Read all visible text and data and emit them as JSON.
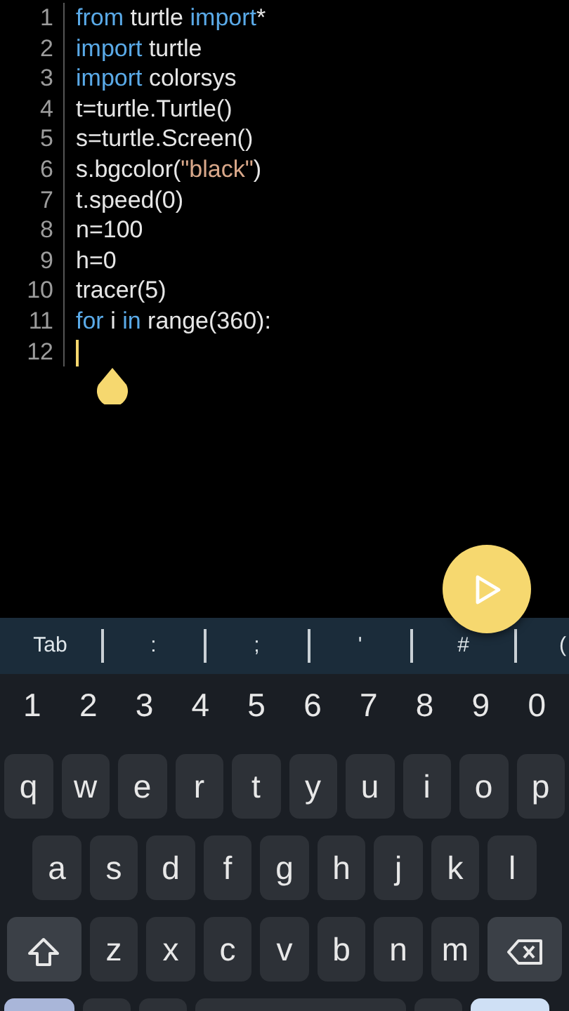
{
  "editor": {
    "lines": [
      {
        "number": "1",
        "cursor": false,
        "tokens": [
          {
            "text": "from",
            "kind": "keyword"
          },
          {
            "text": " turtle ",
            "kind": "plain"
          },
          {
            "text": "import",
            "kind": "keyword"
          },
          {
            "text": "*",
            "kind": "plain"
          }
        ]
      },
      {
        "number": "2",
        "cursor": false,
        "tokens": [
          {
            "text": "import",
            "kind": "keyword"
          },
          {
            "text": " turtle",
            "kind": "plain"
          }
        ]
      },
      {
        "number": "3",
        "cursor": false,
        "tokens": [
          {
            "text": "import",
            "kind": "keyword"
          },
          {
            "text": " colorsys",
            "kind": "plain"
          }
        ]
      },
      {
        "number": "4",
        "cursor": false,
        "tokens": [
          {
            "text": "t=turtle.Turtle()",
            "kind": "plain"
          }
        ]
      },
      {
        "number": "5",
        "cursor": false,
        "tokens": [
          {
            "text": "s=turtle.Screen()",
            "kind": "plain"
          }
        ]
      },
      {
        "number": "6",
        "cursor": false,
        "tokens": [
          {
            "text": "s.bgcolor(",
            "kind": "plain"
          },
          {
            "text": "\"black\"",
            "kind": "string"
          },
          {
            "text": ")",
            "kind": "plain"
          }
        ]
      },
      {
        "number": "7",
        "cursor": false,
        "tokens": [
          {
            "text": "t.speed(0)",
            "kind": "plain"
          }
        ]
      },
      {
        "number": "8",
        "cursor": false,
        "tokens": [
          {
            "text": "n=100",
            "kind": "plain"
          }
        ]
      },
      {
        "number": "9",
        "cursor": false,
        "tokens": [
          {
            "text": "h=0",
            "kind": "plain"
          }
        ]
      },
      {
        "number": "10",
        "cursor": false,
        "tokens": [
          {
            "text": "tracer(5)",
            "kind": "plain"
          }
        ]
      },
      {
        "number": "11",
        "cursor": false,
        "tokens": [
          {
            "text": "for",
            "kind": "keyword"
          },
          {
            "text": " i ",
            "kind": "plain"
          },
          {
            "text": "in",
            "kind": "keyword"
          },
          {
            "text": " range(360):",
            "kind": "plain"
          }
        ]
      },
      {
        "number": "12",
        "cursor": true
      }
    ]
  },
  "toolbar_keys": [
    "Tab",
    ":",
    ";",
    "'",
    "#",
    "("
  ],
  "keyboard": {
    "number_row": [
      "1",
      "2",
      "3",
      "4",
      "5",
      "6",
      "7",
      "8",
      "9",
      "0"
    ],
    "rows": [
      [
        "q",
        "w",
        "e",
        "r",
        "t",
        "y",
        "u",
        "i",
        "o",
        "p"
      ],
      [
        "a",
        "s",
        "d",
        "f",
        "g",
        "h",
        "j",
        "k",
        "l"
      ],
      [
        "z",
        "x",
        "c",
        "v",
        "b",
        "n",
        "m"
      ]
    ]
  }
}
